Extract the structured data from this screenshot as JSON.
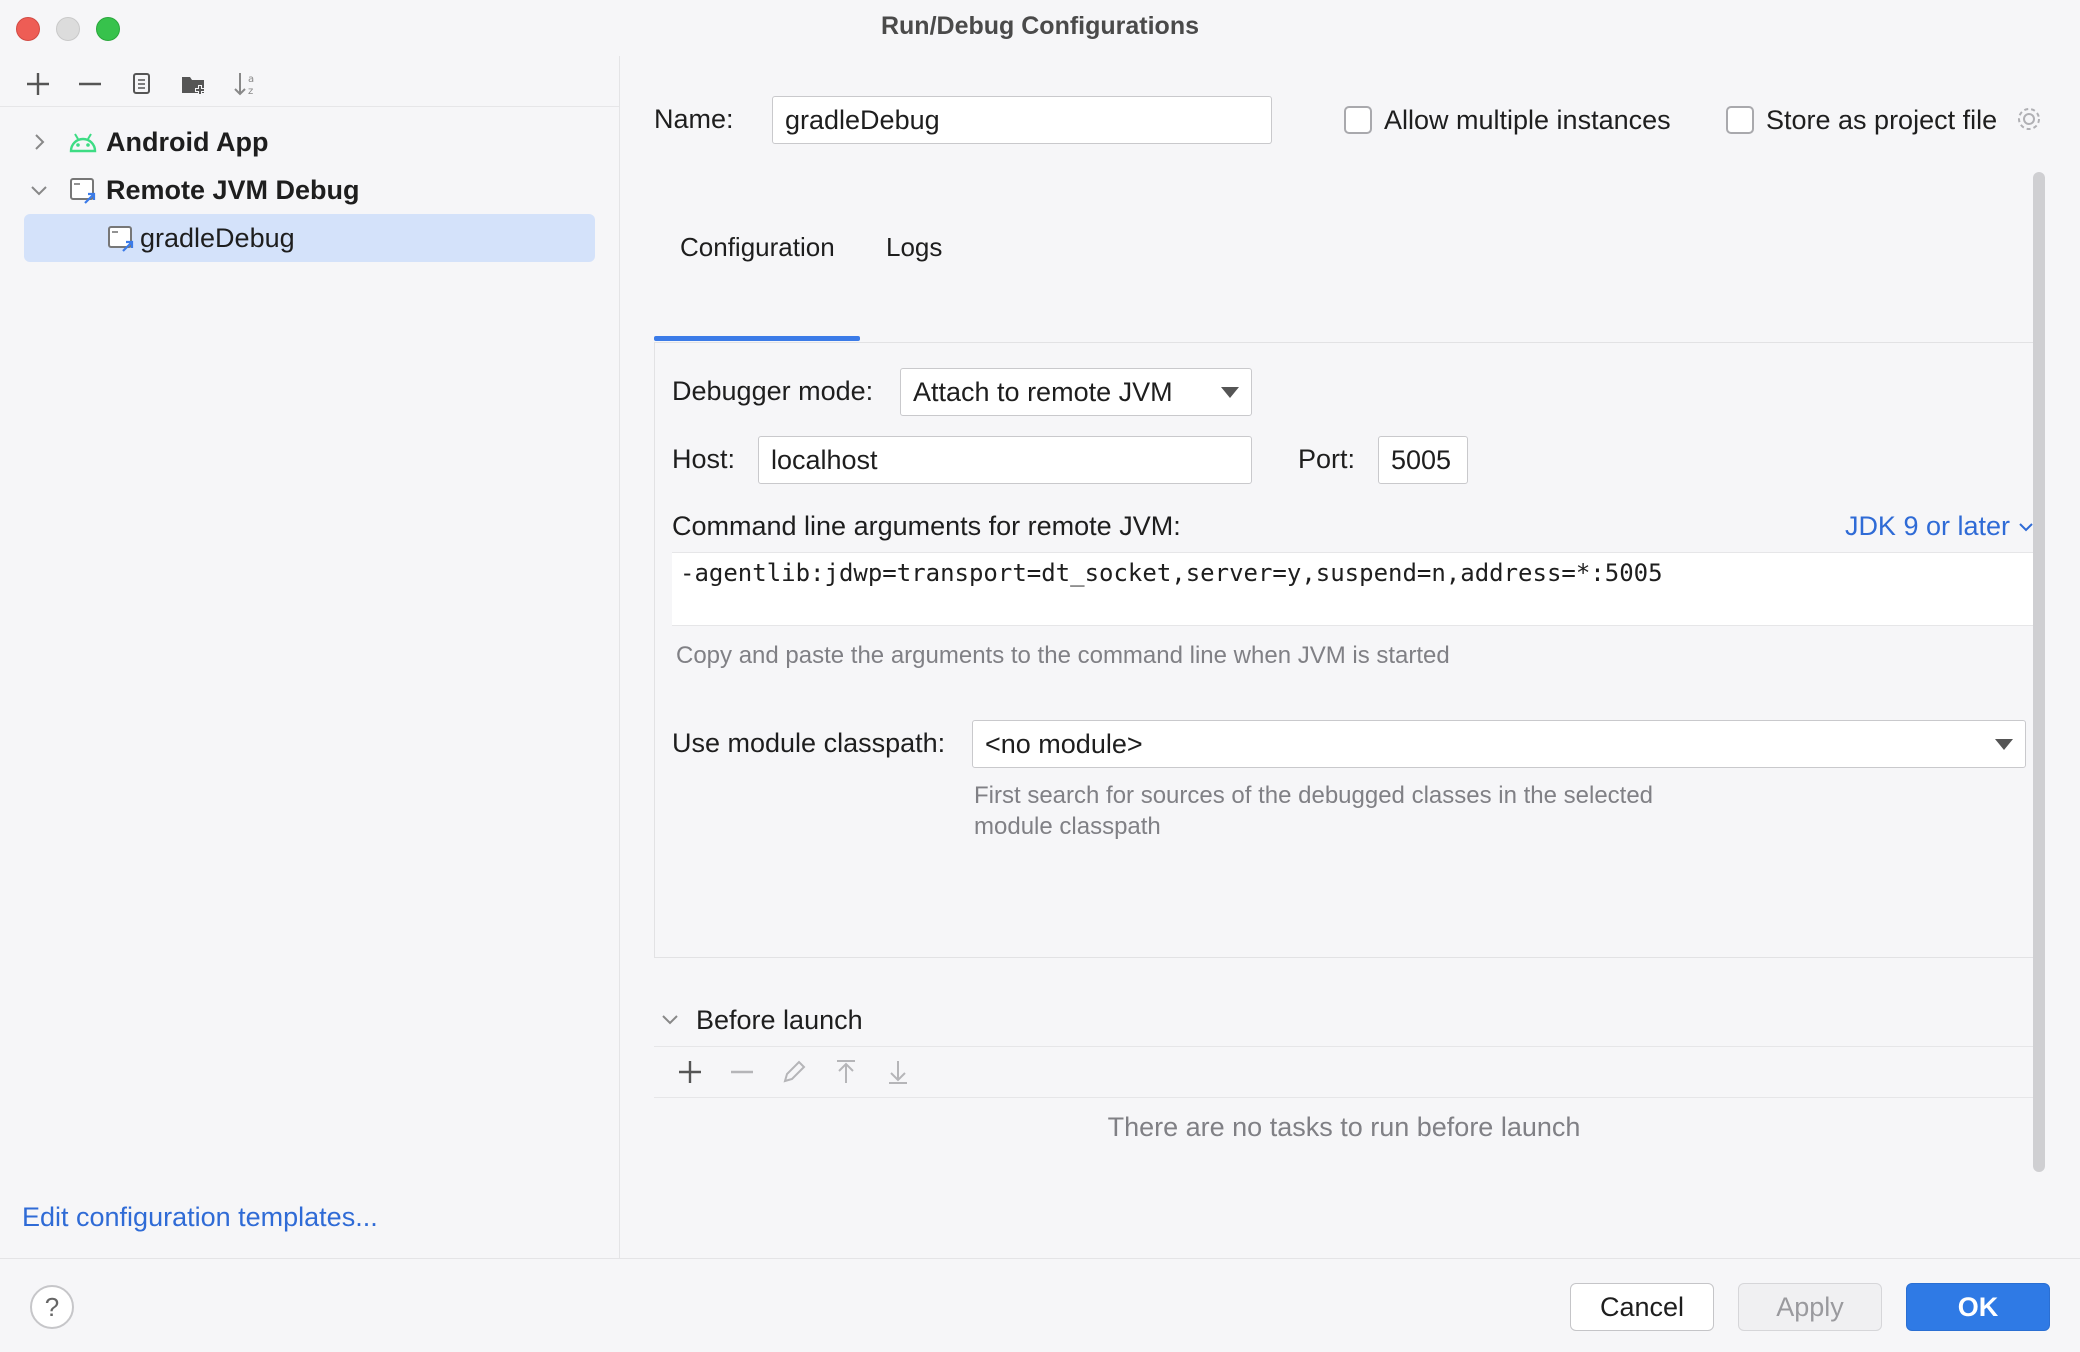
{
  "window": {
    "title": "Run/Debug Configurations"
  },
  "sidebar": {
    "toolbar": [
      "add-icon",
      "remove-icon",
      "copy-icon",
      "new-folder-icon",
      "sort-icon"
    ],
    "tree": [
      {
        "label": "Android App",
        "icon": "android-icon",
        "expanded": false
      },
      {
        "label": "Remote JVM Debug",
        "icon": "remote-debug-icon",
        "expanded": true
      },
      {
        "label": "gradleDebug",
        "icon": "remote-debug-icon",
        "selected": true
      }
    ],
    "edit_templates": "Edit configuration templates..."
  },
  "form": {
    "name_label": "Name:",
    "name_value": "gradleDebug",
    "allow_multiple": "Allow multiple instances",
    "store_project": "Store as project file"
  },
  "tabs": [
    {
      "label": "Configuration",
      "active": true
    },
    {
      "label": "Logs",
      "active": false
    }
  ],
  "config": {
    "debugger_mode_label": "Debugger mode:",
    "debugger_mode_value": "Attach to remote JVM",
    "host_label": "Host:",
    "host_value": "localhost",
    "port_label": "Port:",
    "port_value": "5005",
    "cmd_label": "Command line arguments for remote JVM:",
    "jdk_link": "JDK 9 or later",
    "cmd_value": "-agentlib:jdwp=transport=dt_socket,server=y,suspend=n,address=*:5005",
    "cmd_hint": "Copy and paste the arguments to the command line when JVM is started",
    "module_label": "Use module classpath:",
    "module_value": "<no module>",
    "module_hint_1": "First search for sources of the debugged classes in the selected",
    "module_hint_2": "module classpath"
  },
  "before_launch": {
    "title": "Before launch",
    "toolbar": [
      "add-icon",
      "remove-icon",
      "edit-icon",
      "move-up-icon",
      "move-down-icon"
    ],
    "empty_text": "There are no tasks to run before launch"
  },
  "footer": {
    "help": "?",
    "cancel": "Cancel",
    "apply": "Apply",
    "ok": "OK"
  },
  "colors": {
    "accent": "#2f7ae5",
    "link": "#2f6bd6",
    "selection": "#d4e2fa",
    "android_green": "#3ddc84"
  }
}
